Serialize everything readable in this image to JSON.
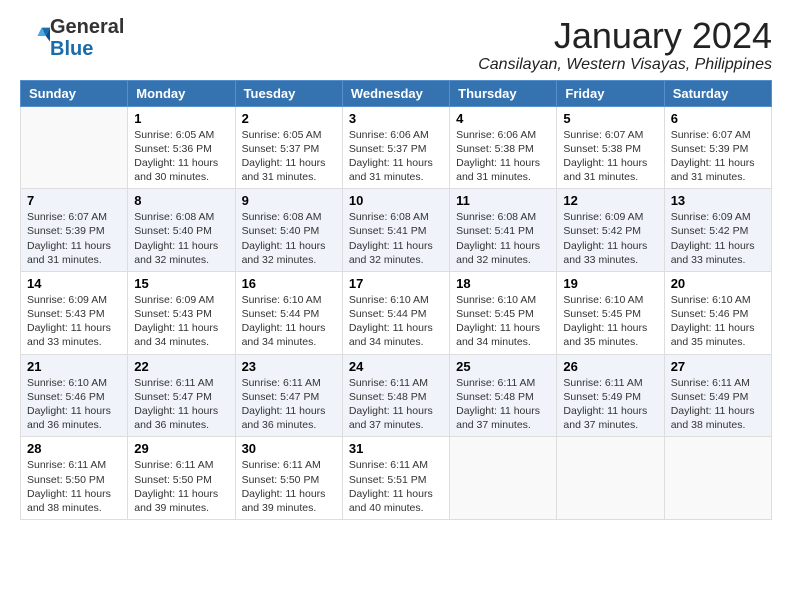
{
  "logo": {
    "general": "General",
    "blue": "Blue"
  },
  "title": "January 2024",
  "location": "Cansilayan, Western Visayas, Philippines",
  "days_header": [
    "Sunday",
    "Monday",
    "Tuesday",
    "Wednesday",
    "Thursday",
    "Friday",
    "Saturday"
  ],
  "weeks": [
    [
      {
        "num": "",
        "info": ""
      },
      {
        "num": "1",
        "info": "Sunrise: 6:05 AM\nSunset: 5:36 PM\nDaylight: 11 hours\nand 30 minutes."
      },
      {
        "num": "2",
        "info": "Sunrise: 6:05 AM\nSunset: 5:37 PM\nDaylight: 11 hours\nand 31 minutes."
      },
      {
        "num": "3",
        "info": "Sunrise: 6:06 AM\nSunset: 5:37 PM\nDaylight: 11 hours\nand 31 minutes."
      },
      {
        "num": "4",
        "info": "Sunrise: 6:06 AM\nSunset: 5:38 PM\nDaylight: 11 hours\nand 31 minutes."
      },
      {
        "num": "5",
        "info": "Sunrise: 6:07 AM\nSunset: 5:38 PM\nDaylight: 11 hours\nand 31 minutes."
      },
      {
        "num": "6",
        "info": "Sunrise: 6:07 AM\nSunset: 5:39 PM\nDaylight: 11 hours\nand 31 minutes."
      }
    ],
    [
      {
        "num": "7",
        "info": "Sunrise: 6:07 AM\nSunset: 5:39 PM\nDaylight: 11 hours\nand 31 minutes."
      },
      {
        "num": "8",
        "info": "Sunrise: 6:08 AM\nSunset: 5:40 PM\nDaylight: 11 hours\nand 32 minutes."
      },
      {
        "num": "9",
        "info": "Sunrise: 6:08 AM\nSunset: 5:40 PM\nDaylight: 11 hours\nand 32 minutes."
      },
      {
        "num": "10",
        "info": "Sunrise: 6:08 AM\nSunset: 5:41 PM\nDaylight: 11 hours\nand 32 minutes."
      },
      {
        "num": "11",
        "info": "Sunrise: 6:08 AM\nSunset: 5:41 PM\nDaylight: 11 hours\nand 32 minutes."
      },
      {
        "num": "12",
        "info": "Sunrise: 6:09 AM\nSunset: 5:42 PM\nDaylight: 11 hours\nand 33 minutes."
      },
      {
        "num": "13",
        "info": "Sunrise: 6:09 AM\nSunset: 5:42 PM\nDaylight: 11 hours\nand 33 minutes."
      }
    ],
    [
      {
        "num": "14",
        "info": "Sunrise: 6:09 AM\nSunset: 5:43 PM\nDaylight: 11 hours\nand 33 minutes."
      },
      {
        "num": "15",
        "info": "Sunrise: 6:09 AM\nSunset: 5:43 PM\nDaylight: 11 hours\nand 34 minutes."
      },
      {
        "num": "16",
        "info": "Sunrise: 6:10 AM\nSunset: 5:44 PM\nDaylight: 11 hours\nand 34 minutes."
      },
      {
        "num": "17",
        "info": "Sunrise: 6:10 AM\nSunset: 5:44 PM\nDaylight: 11 hours\nand 34 minutes."
      },
      {
        "num": "18",
        "info": "Sunrise: 6:10 AM\nSunset: 5:45 PM\nDaylight: 11 hours\nand 34 minutes."
      },
      {
        "num": "19",
        "info": "Sunrise: 6:10 AM\nSunset: 5:45 PM\nDaylight: 11 hours\nand 35 minutes."
      },
      {
        "num": "20",
        "info": "Sunrise: 6:10 AM\nSunset: 5:46 PM\nDaylight: 11 hours\nand 35 minutes."
      }
    ],
    [
      {
        "num": "21",
        "info": "Sunrise: 6:10 AM\nSunset: 5:46 PM\nDaylight: 11 hours\nand 36 minutes."
      },
      {
        "num": "22",
        "info": "Sunrise: 6:11 AM\nSunset: 5:47 PM\nDaylight: 11 hours\nand 36 minutes."
      },
      {
        "num": "23",
        "info": "Sunrise: 6:11 AM\nSunset: 5:47 PM\nDaylight: 11 hours\nand 36 minutes."
      },
      {
        "num": "24",
        "info": "Sunrise: 6:11 AM\nSunset: 5:48 PM\nDaylight: 11 hours\nand 37 minutes."
      },
      {
        "num": "25",
        "info": "Sunrise: 6:11 AM\nSunset: 5:48 PM\nDaylight: 11 hours\nand 37 minutes."
      },
      {
        "num": "26",
        "info": "Sunrise: 6:11 AM\nSunset: 5:49 PM\nDaylight: 11 hours\nand 37 minutes."
      },
      {
        "num": "27",
        "info": "Sunrise: 6:11 AM\nSunset: 5:49 PM\nDaylight: 11 hours\nand 38 minutes."
      }
    ],
    [
      {
        "num": "28",
        "info": "Sunrise: 6:11 AM\nSunset: 5:50 PM\nDaylight: 11 hours\nand 38 minutes."
      },
      {
        "num": "29",
        "info": "Sunrise: 6:11 AM\nSunset: 5:50 PM\nDaylight: 11 hours\nand 39 minutes."
      },
      {
        "num": "30",
        "info": "Sunrise: 6:11 AM\nSunset: 5:50 PM\nDaylight: 11 hours\nand 39 minutes."
      },
      {
        "num": "31",
        "info": "Sunrise: 6:11 AM\nSunset: 5:51 PM\nDaylight: 11 hours\nand 40 minutes."
      },
      {
        "num": "",
        "info": ""
      },
      {
        "num": "",
        "info": ""
      },
      {
        "num": "",
        "info": ""
      }
    ]
  ]
}
